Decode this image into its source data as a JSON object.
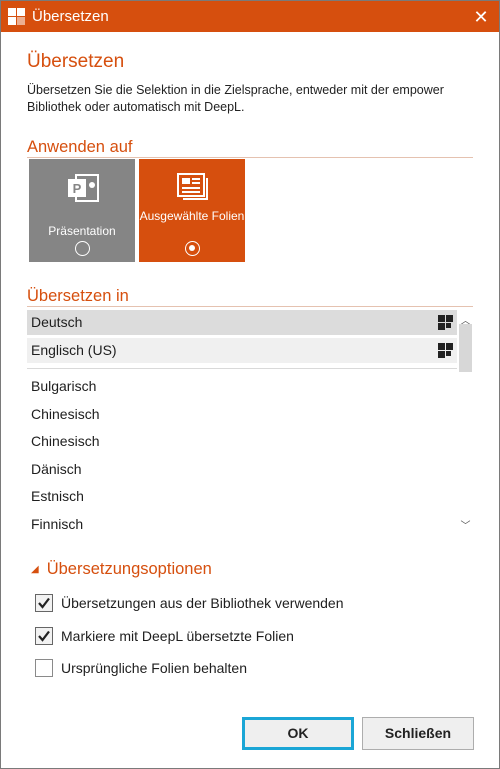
{
  "window": {
    "title": "Übersetzen",
    "close_glyph": "✕"
  },
  "header": {
    "heading": "Übersetzen",
    "description": "Übersetzen Sie die Selektion in die Zielsprache, entweder mit der empower Bibliothek oder automatisch mit DeepL."
  },
  "apply_to": {
    "label": "Anwenden auf",
    "tiles": [
      {
        "label": "Präsentation",
        "selected": false,
        "icon": "powerpoint-icon"
      },
      {
        "label": "Ausgewählte Folien",
        "selected": true,
        "icon": "slides-icon"
      }
    ]
  },
  "translate_into": {
    "label": "Übersetzen in",
    "favorites": [
      {
        "label": "Deutsch",
        "selected": true,
        "icon": "deepl-icon"
      },
      {
        "label": "Englisch (US)",
        "selected": false,
        "icon": "deepl-icon"
      }
    ],
    "languages": [
      "Bulgarisch",
      "Chinesisch",
      "Chinesisch",
      "Dänisch",
      "Estnisch",
      "Finnisch"
    ]
  },
  "options": {
    "label": "Übersetzungsoptionen",
    "items": [
      {
        "label": "Übersetzungen aus der Bibliothek verwenden",
        "checked": true
      },
      {
        "label": "Markiere mit DeepL übersetzte Folien",
        "checked": true
      },
      {
        "label": "Ursprüngliche Folien behalten",
        "checked": false
      }
    ]
  },
  "buttons": {
    "ok": "OK",
    "close": "Schließen"
  },
  "colors": {
    "accent": "#d64f0e",
    "tile_inactive": "#858585",
    "focus_ring": "#1ba6d6"
  }
}
